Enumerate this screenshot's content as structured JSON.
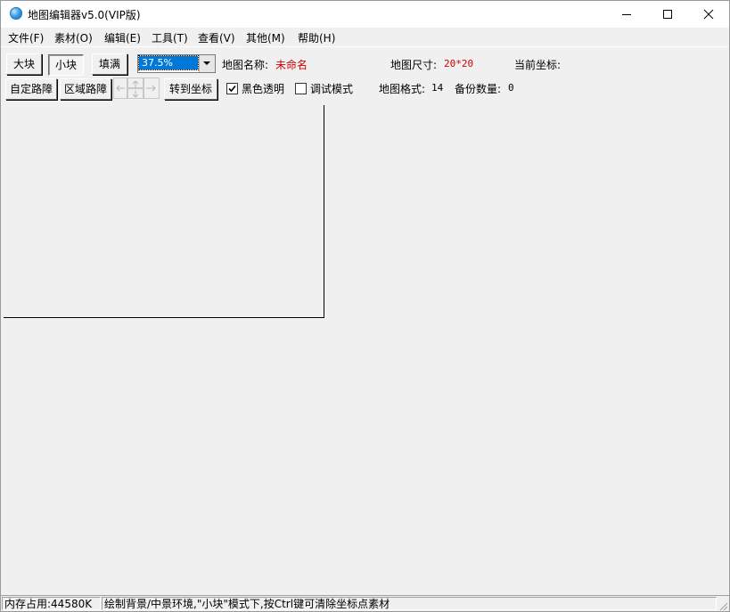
{
  "window": {
    "title": "地图编辑器v5.0(VIP版)",
    "controls": {
      "minimize": "minimize-icon",
      "maximize": "maximize-icon",
      "close": "close-icon"
    }
  },
  "menu": {
    "items": [
      {
        "label": "文件(F)"
      },
      {
        "label": "素材(O)"
      },
      {
        "label": "编辑(E)"
      },
      {
        "label": "工具(T)"
      },
      {
        "label": "查看(V)"
      },
      {
        "label": "其他(M)"
      },
      {
        "label": "帮助(H)"
      }
    ]
  },
  "toolbar": {
    "big_block": "大块",
    "small_block": "小块",
    "fill": "填满",
    "zoom_value": "37.5%",
    "custom_block": "自定路障",
    "area_block": "区域路障",
    "goto_coord": "转到坐标",
    "black_transparent": "黑色透明",
    "black_transparent_checked": true,
    "debug_mode": "调试模式",
    "debug_mode_checked": false
  },
  "info": {
    "map_name_label": "地图名称:",
    "map_name_value": "未命名",
    "map_size_label": "地图尺寸:",
    "map_size_value": "20*20",
    "current_coord_label": "当前坐标:",
    "map_format_label": "地图格式:",
    "map_format_value": "14",
    "backup_count_label": "备份数量:",
    "backup_count_value": "0"
  },
  "status": {
    "memory": "内存占用:44580K",
    "hint": "绘制背景/中景环境,\"小块\"模式下,按Ctrl键可清除坐标点素材"
  },
  "colors": {
    "accent_selection": "#0078d7",
    "value_red": "#d10000",
    "background": "#f0f0f0"
  }
}
